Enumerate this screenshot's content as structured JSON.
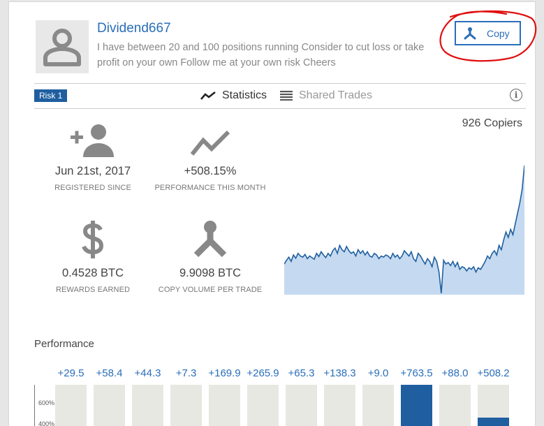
{
  "profile": {
    "name": "Dividend667",
    "description": "I have between 20 and 100 positions running Consider to cut loss or take profit on your own Follow me at your own risk Cheers",
    "avatar_icon": "person-icon"
  },
  "copy_button": {
    "label": "Copy",
    "icon": "split-arrow-icon"
  },
  "risk_badge": "Risk 1",
  "tabs": [
    {
      "label": "Statistics",
      "icon": "trend-icon",
      "active": true
    },
    {
      "label": "Shared Trades",
      "icon": "list-icon",
      "active": false
    }
  ],
  "info_icon": "i",
  "copiers": "926 Copiers",
  "stats": [
    {
      "icon": "add-person-icon",
      "value": "Jun 21st, 2017",
      "label": "REGISTERED SINCE"
    },
    {
      "icon": "trend-icon",
      "value": "+508.15%",
      "label": "PERFORMANCE THIS MONTH"
    },
    {
      "icon": "dollar-icon",
      "value": "0.4528 BTC",
      "label": "REWARDS EARNED"
    },
    {
      "icon": "split-arrow-icon",
      "value": "9.9098 BTC",
      "label": "COPY VOLUME PER TRADE"
    }
  ],
  "chart_data": {
    "type": "area",
    "title": "",
    "xlabel": "",
    "ylabel": "",
    "color": "#1f5fa0",
    "fill": "#c5daf0",
    "values": [
      35,
      42,
      48,
      40,
      52,
      46,
      55,
      50,
      48,
      53,
      45,
      50,
      47,
      44,
      55,
      49,
      58,
      52,
      47,
      55,
      50,
      60,
      65,
      55,
      70,
      62,
      58,
      68,
      60,
      55,
      58,
      50,
      62,
      55,
      60,
      52,
      58,
      50,
      48,
      55,
      52,
      45,
      50,
      48,
      52,
      50,
      45,
      55,
      48,
      52,
      45,
      50,
      60,
      55,
      50,
      58,
      45,
      40,
      55,
      50,
      42,
      35,
      45,
      40,
      30,
      48,
      40,
      20,
      -20,
      42,
      35,
      38,
      32,
      40,
      30,
      38,
      25,
      30,
      28,
      22,
      28,
      25,
      30,
      20,
      28,
      25,
      32,
      40,
      50,
      45,
      55,
      60,
      52,
      70,
      62,
      80,
      95,
      85,
      100,
      90,
      110,
      130,
      150,
      175,
      220
    ]
  },
  "performance": {
    "title": "Performance",
    "months": [
      {
        "value": "+29.5",
        "fill": 0
      },
      {
        "value": "+58.4",
        "fill": 0
      },
      {
        "value": "+44.3",
        "fill": 0
      },
      {
        "value": "+7.3",
        "fill": 0
      },
      {
        "value": "+169.9",
        "fill": 0
      },
      {
        "value": "+265.9",
        "fill": 0
      },
      {
        "value": "+65.3",
        "fill": 0
      },
      {
        "value": "+138.3",
        "fill": 0
      },
      {
        "value": "+9.0",
        "fill": 0
      },
      {
        "value": "+763.5",
        "fill": 1
      },
      {
        "value": "+88.0",
        "fill": 0
      },
      {
        "value": "+508.2",
        "fill": 0.33
      }
    ],
    "y_ticks": [
      "600%",
      "400%"
    ]
  }
}
